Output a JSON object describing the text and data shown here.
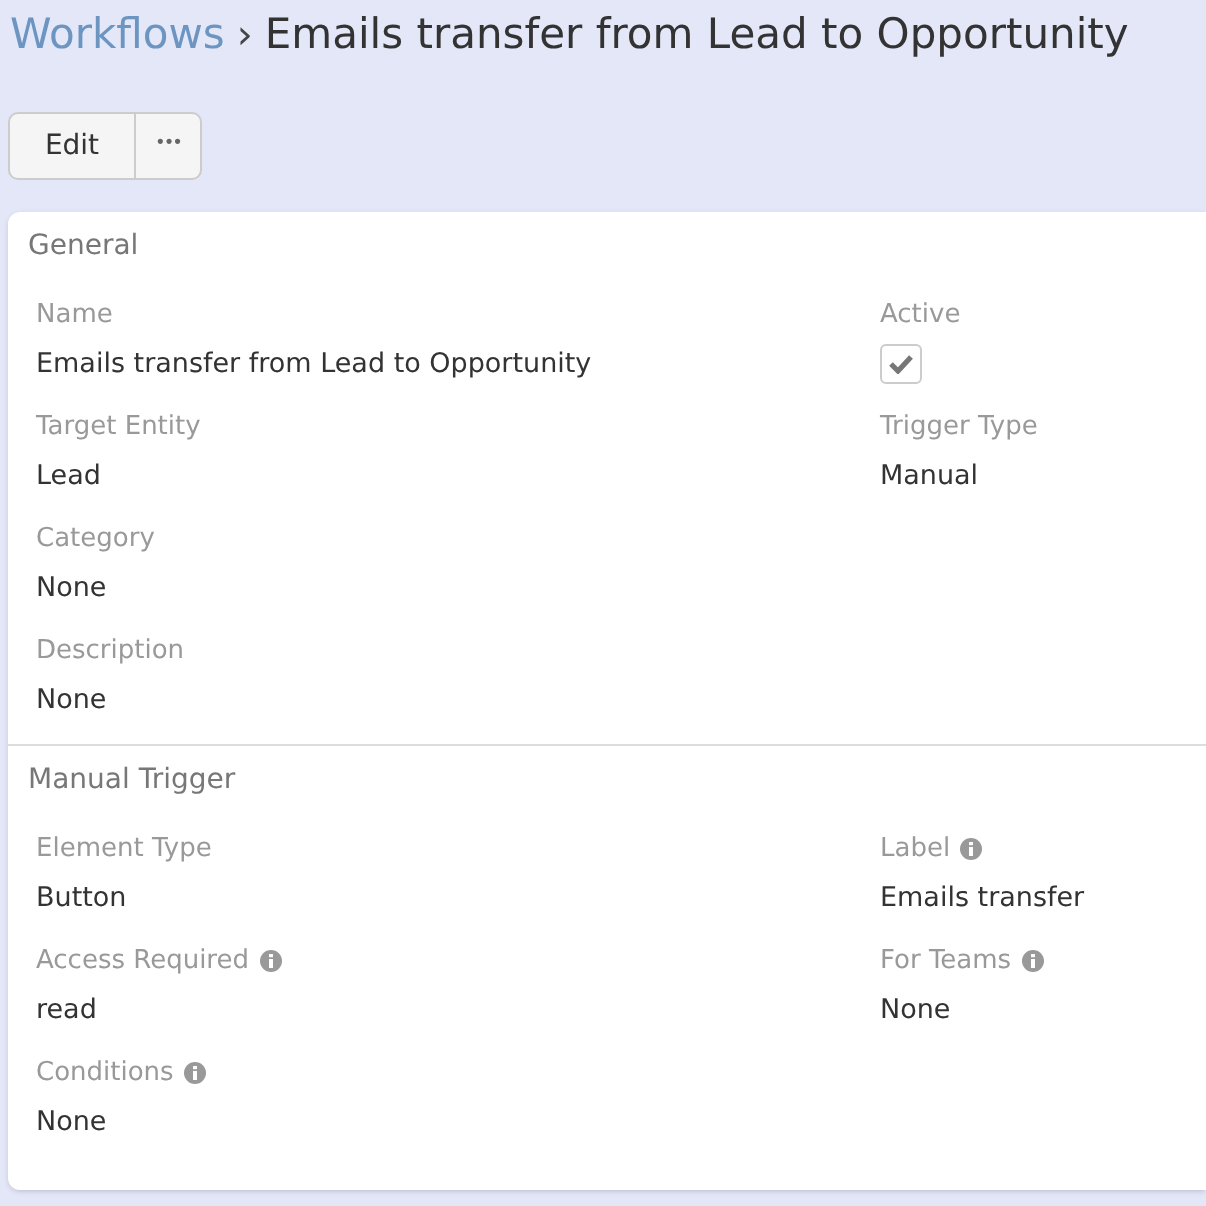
{
  "breadcrumb": {
    "link": "Workflows",
    "separator": "›",
    "title": "Emails transfer from Lead to Opportunity"
  },
  "buttons": [
    {
      "kind": "text",
      "label": "Edit"
    },
    {
      "kind": "more",
      "label": "•••"
    }
  ],
  "panels": [
    {
      "title": "General",
      "rows": [
        [
          {
            "label": "Name",
            "kind": "text",
            "value": "Emails transfer from Lead to Opportunity"
          },
          {
            "label": "Active",
            "kind": "checkbox",
            "checked": true
          }
        ],
        [
          {
            "label": "Target Entity",
            "kind": "text",
            "value": "Lead"
          },
          {
            "label": "Trigger Type",
            "kind": "text",
            "value": "Manual"
          }
        ],
        [
          {
            "label": "Category",
            "kind": "text",
            "value": "None"
          }
        ],
        [
          {
            "label": "Description",
            "kind": "text",
            "value": "None"
          }
        ]
      ]
    },
    {
      "title": "Manual Trigger",
      "rows": [
        [
          {
            "label": "Element Type",
            "kind": "text",
            "value": "Button"
          },
          {
            "label": "Label",
            "kind": "text",
            "value": "Emails transfer",
            "info": true
          }
        ],
        [
          {
            "label": "Access Required",
            "kind": "text",
            "value": "read",
            "info": true
          },
          {
            "label": "For Teams",
            "kind": "text",
            "value": "None",
            "info": true
          }
        ],
        [
          {
            "label": "Conditions",
            "kind": "text",
            "value": "None",
            "info": true
          }
        ]
      ]
    }
  ]
}
